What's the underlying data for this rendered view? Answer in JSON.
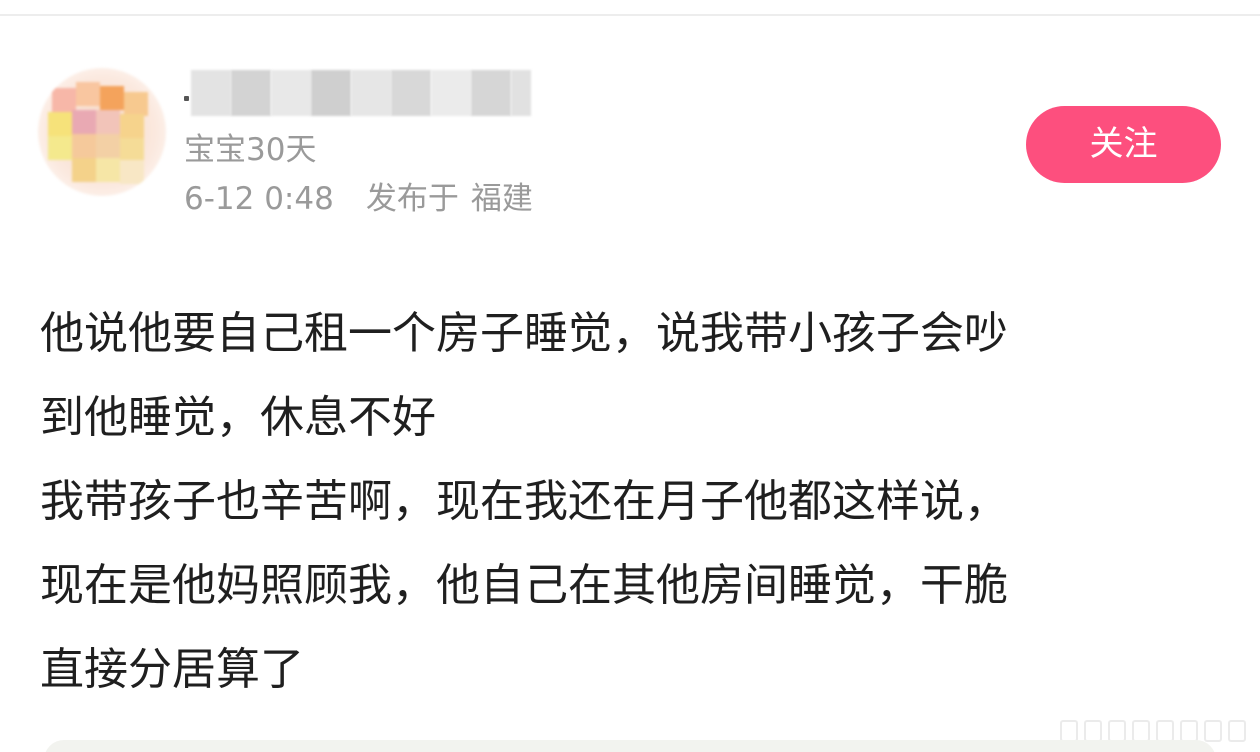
{
  "author": {
    "badge": "宝宝30天",
    "post_time": "6-12 0:48",
    "location_prefix": "发布于",
    "location": "福建"
  },
  "follow_button_label": "关注",
  "post": {
    "lines": [
      "他说他要自己租一个房子睡觉，说我带小孩子会吵",
      "到他睡觉，休息不好",
      "我带孩子也辛苦啊，现在我还在月子他都这样说，",
      "现在是他妈照顾我，他自己在其他房间睡觉，干脆",
      "直接分居算了"
    ]
  },
  "colors": {
    "follow_button": "#fd4f7e",
    "meta_text": "#9a9a9a",
    "body_text": "#1f1f1f"
  }
}
